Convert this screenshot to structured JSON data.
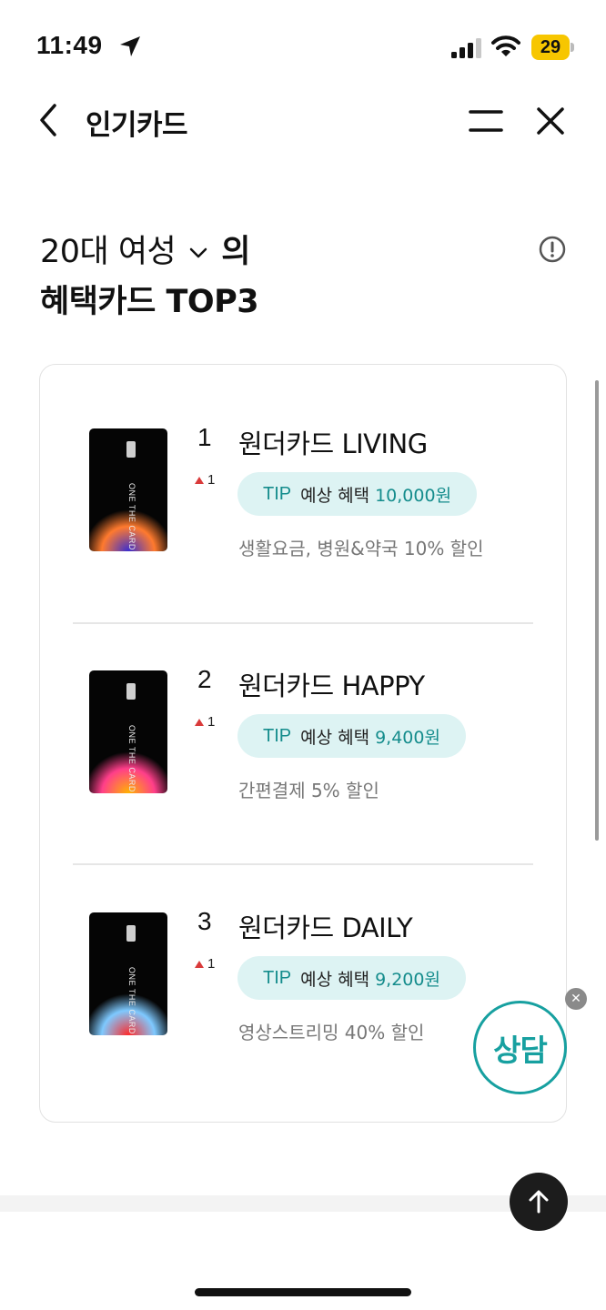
{
  "status_bar": {
    "time": "11:49",
    "battery": "29",
    "icons": [
      "location-arrow-icon",
      "signal-icon",
      "wifi-icon",
      "battery-icon"
    ]
  },
  "header": {
    "title": "인기카드",
    "icons": [
      "back-icon",
      "menu-icon",
      "close-icon"
    ]
  },
  "heading": {
    "audience": "20대 여성",
    "suffix": "의",
    "line2": "혜택카드 TOP3"
  },
  "cards": [
    {
      "rank": "1",
      "rank_change": "1",
      "name": "원더카드 LIVING",
      "tip_label": "TIP",
      "tip_text": "예상 혜택",
      "tip_amount": "10,000원",
      "benefit": "생활요금, 병원&약국 10% 할인",
      "card_brand": "ONE THE CARD",
      "colors": [
        "#3a2ed0",
        "#ff7a2e"
      ]
    },
    {
      "rank": "2",
      "rank_change": "1",
      "name": "원더카드 HAPPY",
      "tip_label": "TIP",
      "tip_text": "예상 혜택",
      "tip_amount": "9,400원",
      "benefit": "간편결제 5% 할인",
      "card_brand": "ONE THE CARD",
      "colors": [
        "#ffb300",
        "#ff3e8a"
      ]
    },
    {
      "rank": "3",
      "rank_change": "1",
      "name": "원더카드 DAILY",
      "tip_label": "TIP",
      "tip_text": "예상 혜택",
      "tip_amount": "9,200원",
      "benefit": "영상스트리밍 40% 할인",
      "card_brand": "ONE THE CARD",
      "colors": [
        "#ff2a2a",
        "#7ec9ff"
      ]
    }
  ],
  "floating": {
    "consult_label": "상담",
    "close_glyph": "✕"
  },
  "colors": {
    "accent": "#17a0a0",
    "tip_bg": "#ddf3f3",
    "up_arrow": "#d93a3a",
    "battery": "#f7c600"
  }
}
